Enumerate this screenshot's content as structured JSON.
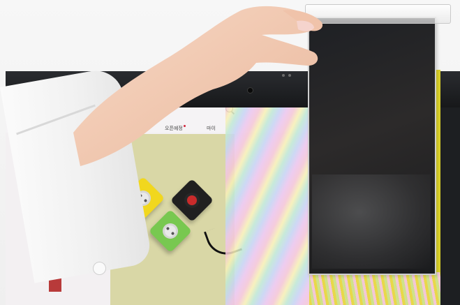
{
  "screen": {
    "nav": [
      "오픈예정",
      "마이"
    ]
  },
  "icons": {
    "search": "search-icon"
  }
}
